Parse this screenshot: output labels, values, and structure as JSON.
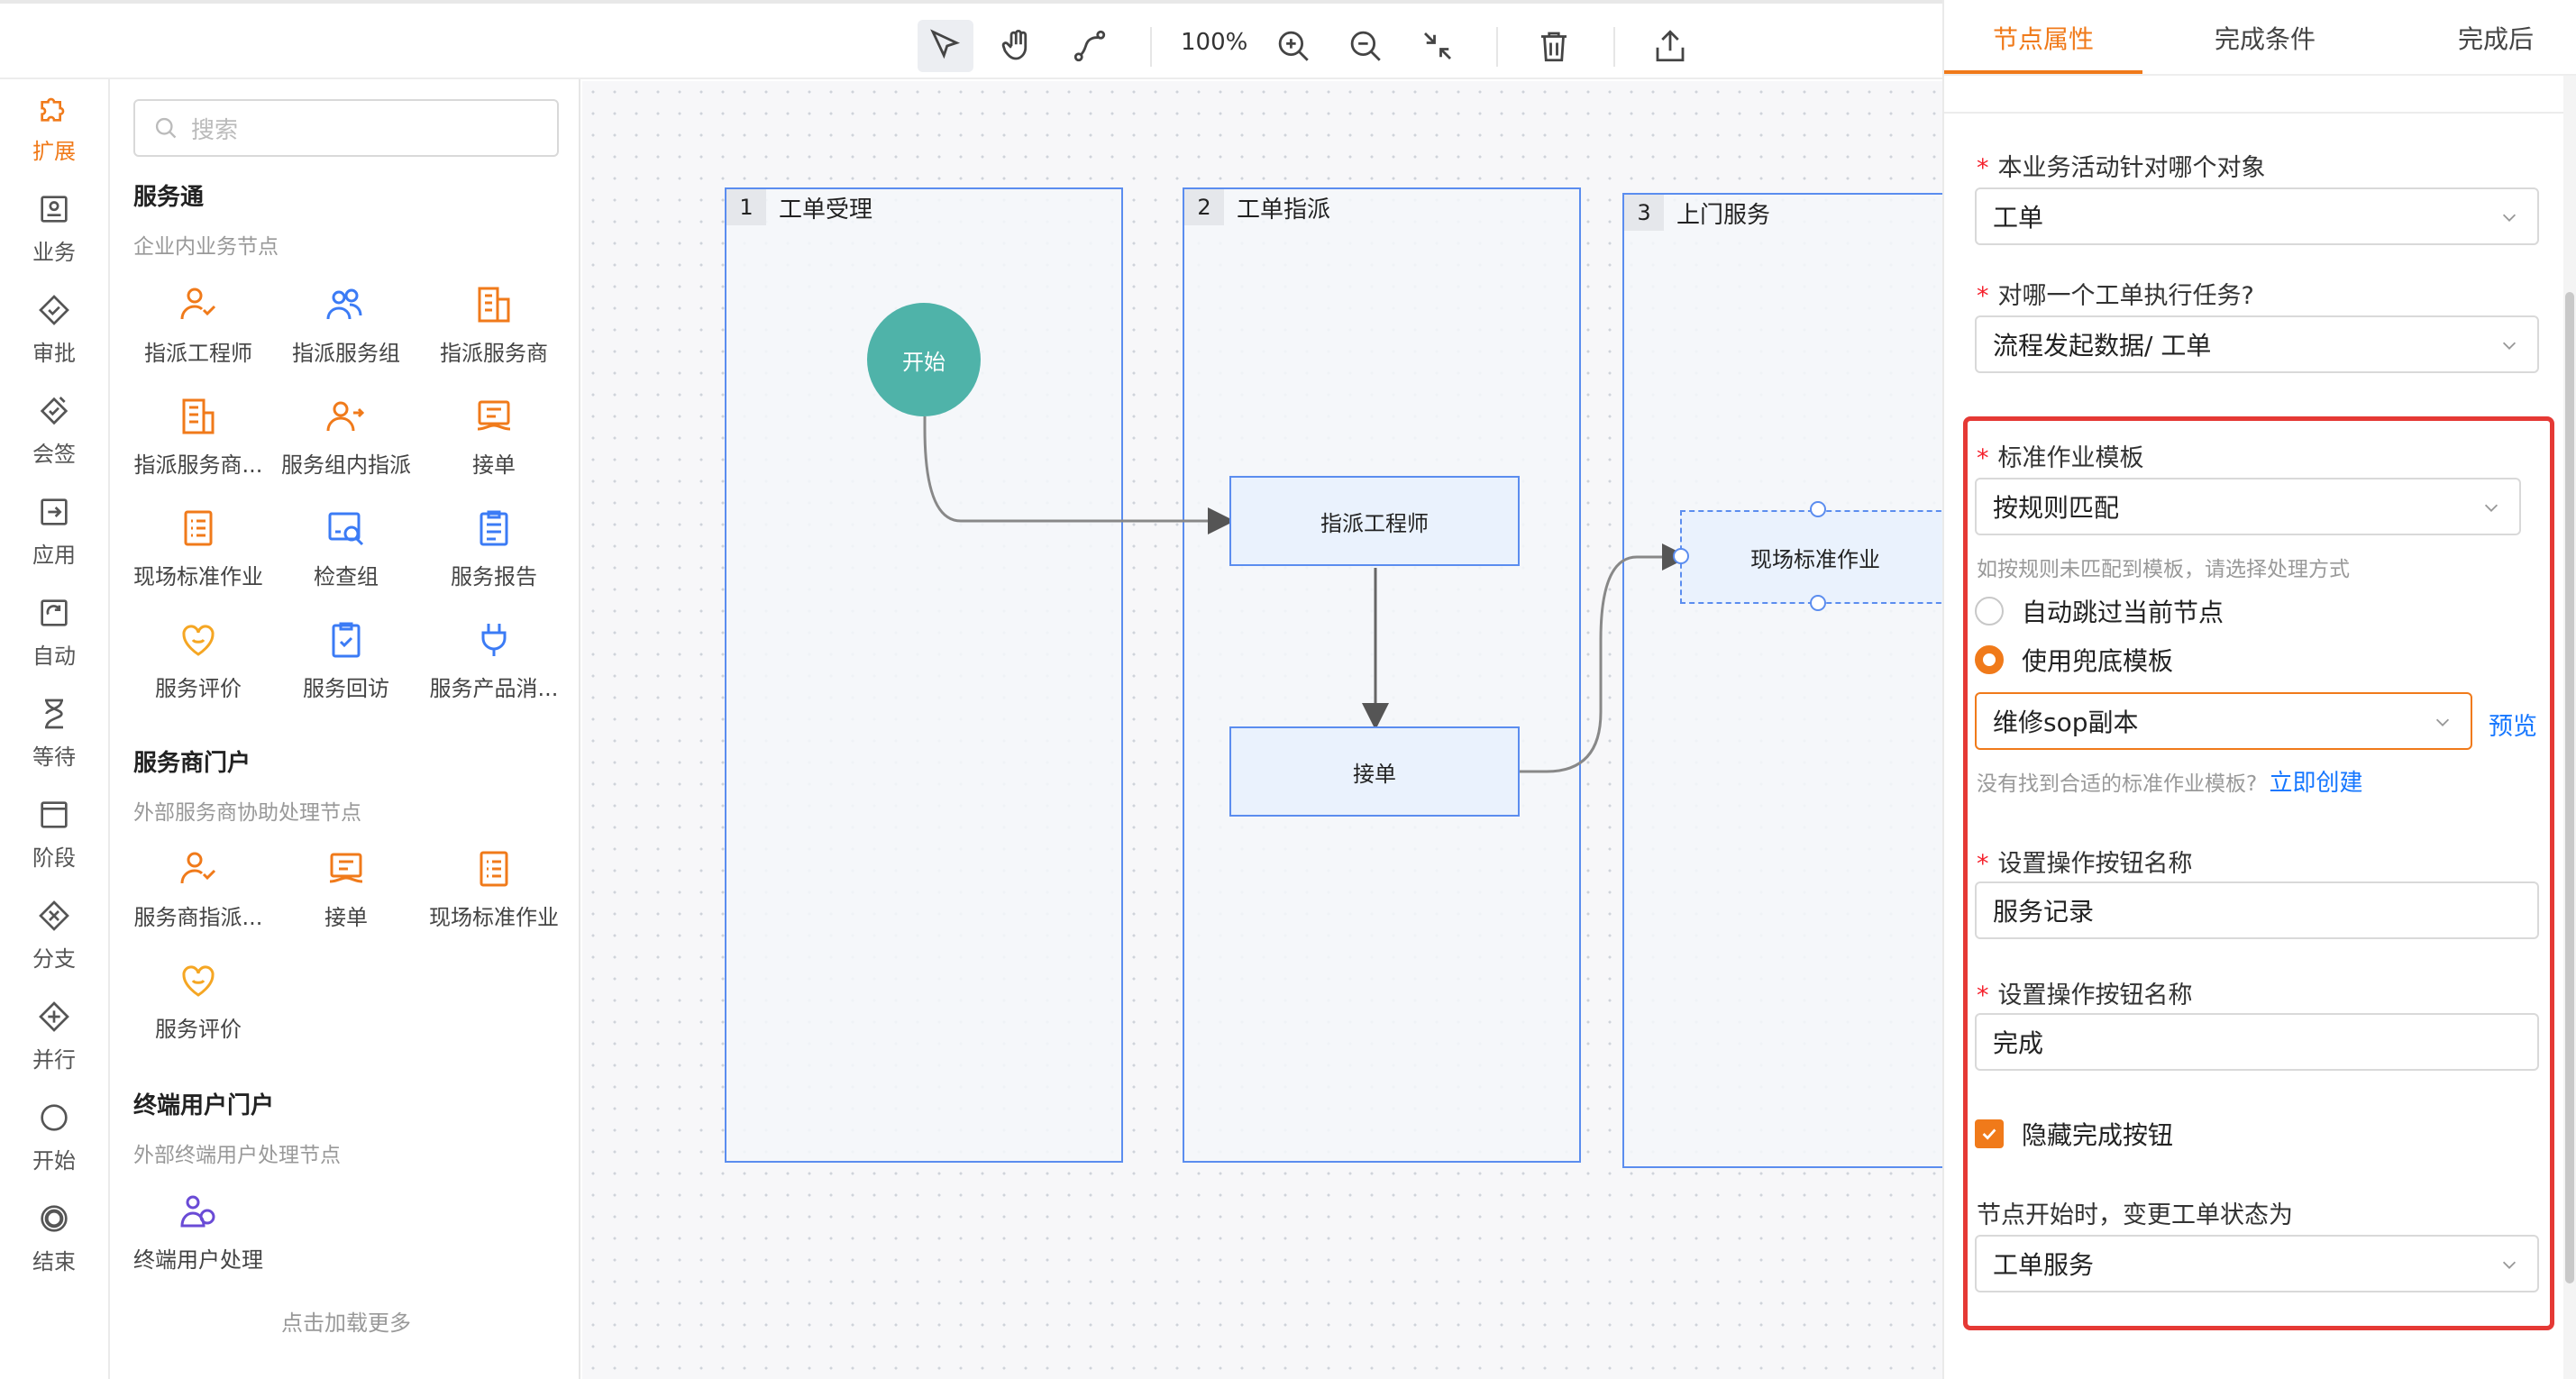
{
  "toolbar": {
    "zoom": "100%",
    "icons": [
      "select-icon",
      "hand-icon",
      "connector-icon",
      "zoom-in-icon",
      "zoom-out-icon",
      "fit-icon",
      "delete-icon",
      "export-icon"
    ]
  },
  "rail": {
    "items": [
      {
        "label": "扩展",
        "icon": "puzzle-icon"
      },
      {
        "label": "业务",
        "icon": "business-icon"
      },
      {
        "label": "审批",
        "icon": "approve-icon"
      },
      {
        "label": "会签",
        "icon": "countersign-icon"
      },
      {
        "label": "应用",
        "icon": "app-icon"
      },
      {
        "label": "自动",
        "icon": "auto-icon"
      },
      {
        "label": "等待",
        "icon": "hourglass-icon"
      },
      {
        "label": "阶段",
        "icon": "stage-icon"
      },
      {
        "label": "分支",
        "icon": "branch-icon"
      },
      {
        "label": "并行",
        "icon": "parallel-icon"
      },
      {
        "label": "开始",
        "icon": "start-icon"
      },
      {
        "label": "结束",
        "icon": "end-icon"
      }
    ]
  },
  "palette": {
    "search_placeholder": "搜索",
    "sections": [
      {
        "title": "服务通",
        "subtitle": "企业内业务节点",
        "items": [
          "指派工程师",
          "指派服务组",
          "指派服务商",
          "指派服务商...",
          "服务组内指派",
          "接单",
          "现场标准作业",
          "检查组",
          "服务报告",
          "服务评价",
          "服务回访",
          "服务产品消..."
        ]
      },
      {
        "title": "服务商门户",
        "subtitle": "外部服务商协助处理节点",
        "items": [
          "服务商指派...",
          "接单",
          "现场标准作业",
          "服务评价"
        ]
      },
      {
        "title": "终端用户门户",
        "subtitle": "外部终端用户处理节点",
        "items": [
          "终端用户处理"
        ]
      }
    ],
    "load_more": "点击加载更多"
  },
  "canvas": {
    "lanes": [
      {
        "num": "1",
        "title": "工单受理"
      },
      {
        "num": "2",
        "title": "工单指派"
      },
      {
        "num": "3",
        "title": "上门服务"
      }
    ],
    "nodes": {
      "start": "开始",
      "assign_engineer": "指派工程师",
      "accept": "接单",
      "onsite_sop": "现场标准作业"
    }
  },
  "panel": {
    "tabs": [
      "节点属性",
      "完成条件",
      "完成后"
    ],
    "target_object_label": "本业务活动针对哪个对象",
    "target_object_value": "工单",
    "which_order_label": "对哪一个工单执行任务?",
    "which_order_value": "流程发起数据/ 工单",
    "sop_template_label": "标准作业模板",
    "sop_template_value": "按规则匹配",
    "sop_hint": "如按规则未匹配到模板，请选择处理方式",
    "radio_skip": "自动跳过当前节点",
    "radio_fallback": "使用兜底模板",
    "fallback_template_value": "维修sop副本",
    "preview_link": "预览",
    "not_found_hint": "没有找到合适的标准作业模板?",
    "create_link": "立即创建",
    "op_button_label_1": "设置操作按钮名称",
    "op_button_value_1": "服务记录",
    "op_button_label_2": "设置操作按钮名称",
    "op_button_value_2": "完成",
    "hide_complete_label": "隐藏完成按钮",
    "status_change_label": "节点开始时，变更工单状态为",
    "status_change_value": "工单服务"
  },
  "colors": {
    "accent": "#f07a1a",
    "lane_border": "#5b8def",
    "node_fill": "#eaf2fd",
    "start_fill": "#4fb3a9",
    "link": "#1677ff",
    "highlight": "#e53935"
  }
}
